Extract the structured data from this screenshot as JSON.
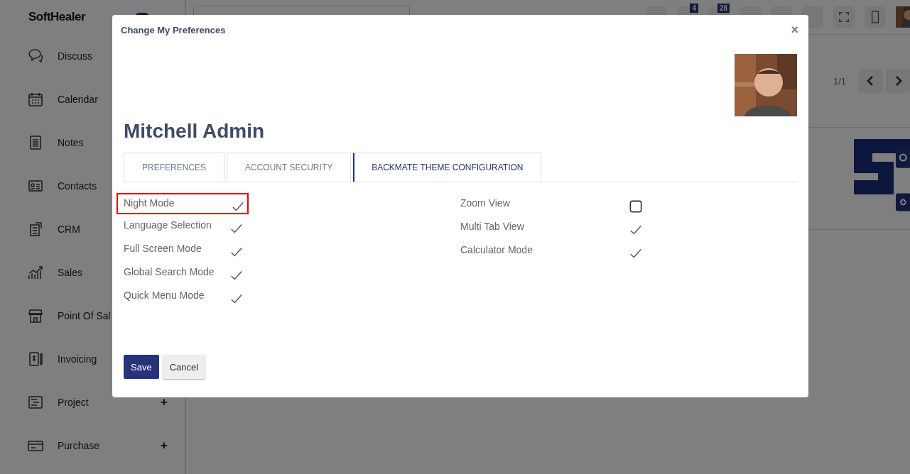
{
  "app": {
    "brand": "SoftHealer",
    "menu": [
      {
        "label": "Discuss"
      },
      {
        "label": "Calendar"
      },
      {
        "label": "Notes"
      },
      {
        "label": "Contacts"
      },
      {
        "label": "CRM"
      },
      {
        "label": "Sales"
      },
      {
        "label": "Point Of Sal"
      },
      {
        "label": "Invoicing"
      },
      {
        "label": "Project",
        "expander": "+"
      },
      {
        "label": "Purchase",
        "expander": "+"
      }
    ],
    "topbar": {
      "badges": [
        "4",
        "28"
      ]
    },
    "pager": "1/1"
  },
  "dialog": {
    "title": "Change My Preferences",
    "close": "×",
    "user_name": "Mitchell Admin",
    "tabs": [
      {
        "label": "PREFERENCES",
        "selected": false
      },
      {
        "label": "ACCOUNT SECURITY",
        "selected": false
      },
      {
        "label": "BACKMATE THEME CONFIGURATION",
        "selected": true
      }
    ],
    "settings_left": [
      {
        "label": "Night Mode",
        "checked": true,
        "focused": true
      },
      {
        "label": "Language Selection",
        "checked": true,
        "focused": false
      },
      {
        "label": "Full Screen Mode",
        "checked": true,
        "focused": false
      },
      {
        "label": "Global Search Mode",
        "checked": true,
        "focused": false
      },
      {
        "label": "Quick Menu Mode",
        "checked": true,
        "focused": false
      }
    ],
    "settings_right": [
      {
        "label": "Zoom View",
        "checked": false,
        "focused": false
      },
      {
        "label": "Multi Tab View",
        "checked": true,
        "focused": false
      },
      {
        "label": "Calculator Mode",
        "checked": true,
        "focused": false
      }
    ],
    "buttons": [
      {
        "label": "Save",
        "kind": "primary"
      },
      {
        "label": "Cancel",
        "kind": "secondary"
      }
    ]
  }
}
